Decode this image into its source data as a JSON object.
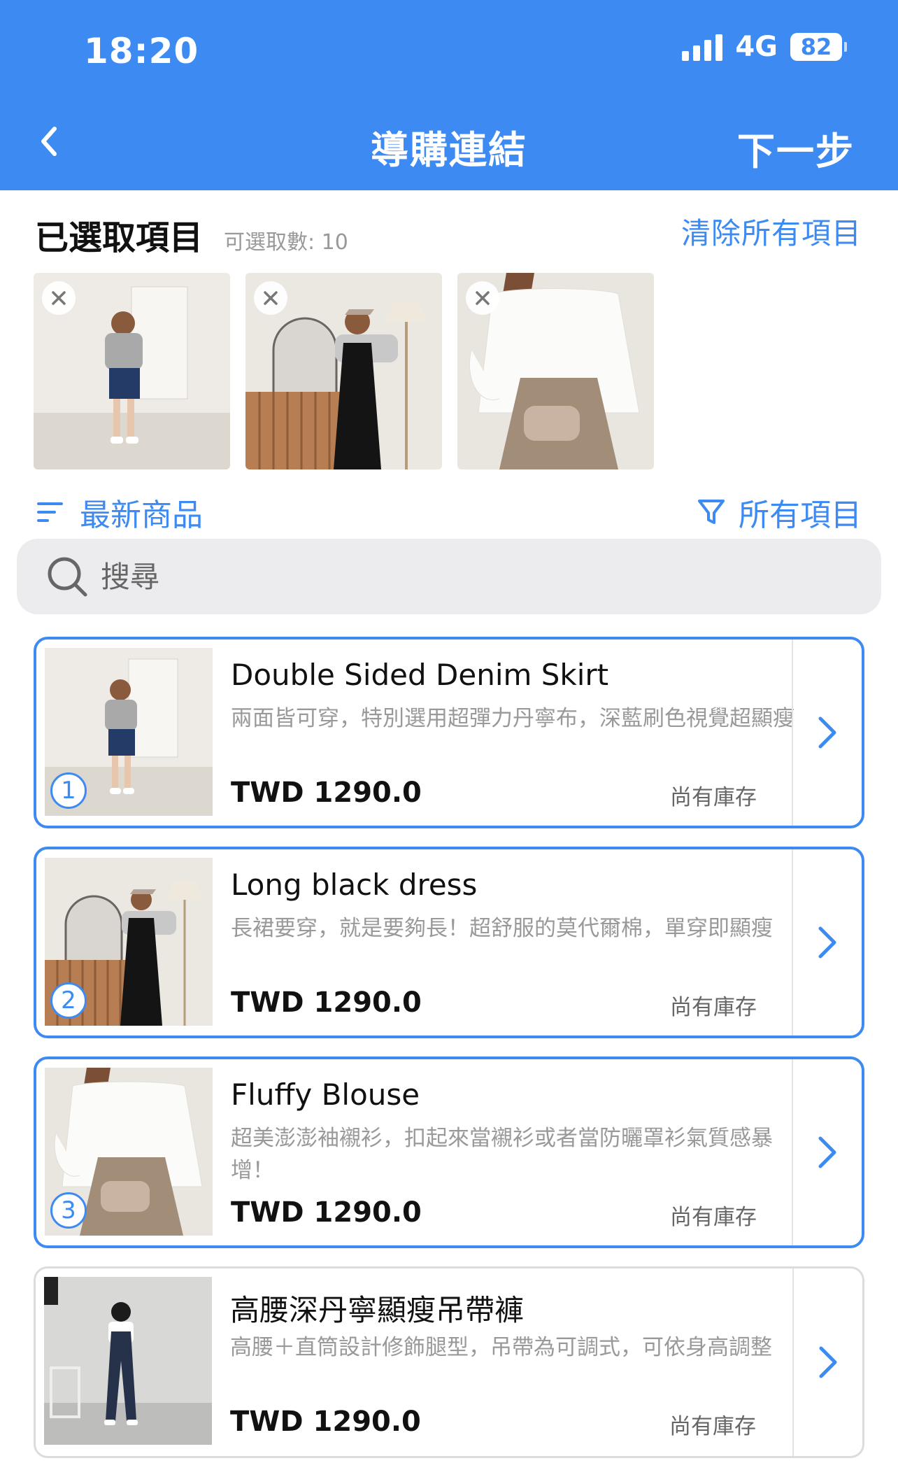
{
  "status": {
    "time": "18:20",
    "network": "4G",
    "battery": "82"
  },
  "nav": {
    "title": "導購連結",
    "next_label": "下一步"
  },
  "selected": {
    "title": "已選取項目",
    "count_label": "可選取數: 10",
    "clear_label": "清除所有項目"
  },
  "sort": {
    "label": "最新商品"
  },
  "filter": {
    "label": "所有項目"
  },
  "search": {
    "placeholder": "搜尋"
  },
  "products": [
    {
      "index": "1",
      "name": "Double Sided Denim Skirt",
      "desc": "兩面皆可穿，特別選用超彈力丹寧布，深藍刷色視覺超顯瘦",
      "price": "TWD 1290.0",
      "stock": "尚有庫存"
    },
    {
      "index": "2",
      "name": "Long black dress",
      "desc": "長裙要穿，就是要夠長！超舒服的莫代爾棉，單穿即顯瘦",
      "price": "TWD 1290.0",
      "stock": "尚有庫存"
    },
    {
      "index": "3",
      "name": "Fluffy Blouse",
      "desc": "超美澎澎袖襯衫，扣起來當襯衫或者當防曬罩衫氣質感暴增！",
      "price": "TWD 1290.0",
      "stock": "尚有庫存"
    },
    {
      "index": "",
      "name": "高腰深丹寧顯瘦吊帶褲",
      "desc": "高腰＋直筒設計修飾腿型，吊帶為可調式，可依身高調整",
      "price": "TWD 1290.0",
      "stock": "尚有庫存"
    }
  ],
  "colors": {
    "accent": "#3d8bf2",
    "muted": "#999999"
  },
  "icons": [
    "chevron-left-icon",
    "close-icon",
    "sort-lines-icon",
    "filter-funnel-icon",
    "search-icon",
    "chevron-right-icon"
  ]
}
